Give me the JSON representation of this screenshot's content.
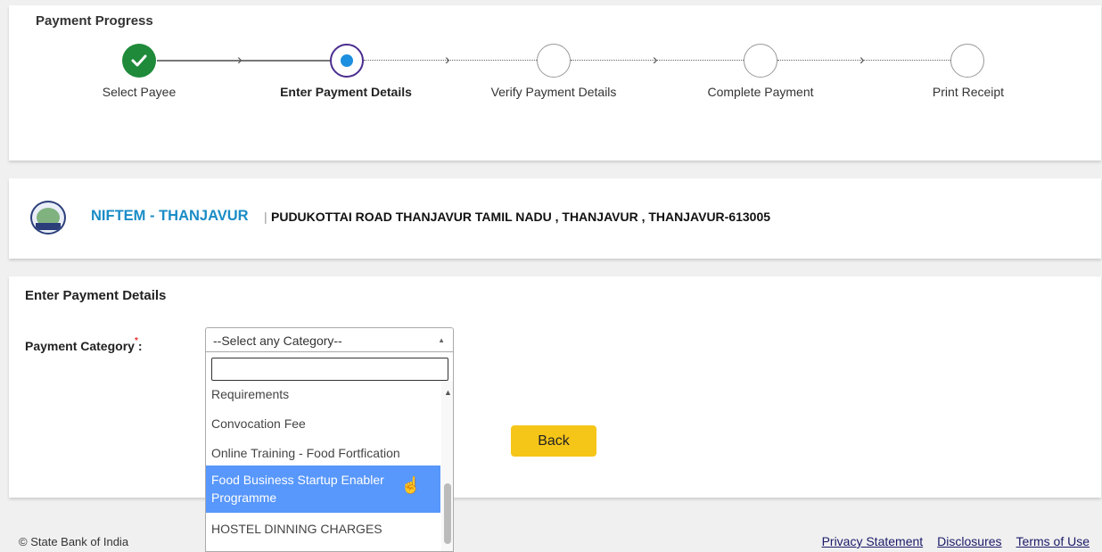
{
  "progress": {
    "title": "Payment Progress",
    "steps": [
      {
        "label": "Select Payee",
        "state": "done"
      },
      {
        "label": "Enter Payment Details",
        "state": "active"
      },
      {
        "label": "Verify Payment Details",
        "state": "pending"
      },
      {
        "label": "Complete Payment",
        "state": "pending"
      },
      {
        "label": "Print Receipt",
        "state": "pending"
      }
    ]
  },
  "organization": {
    "name": "NIFTEM - THANJAVUR",
    "separator": "|",
    "address": "PUDUKOTTAI ROAD THANJAVUR TAMIL NADU , THANJAVUR , THANJAVUR-613005",
    "logo_icon": "niftem-logo-icon"
  },
  "form": {
    "title": "Enter Payment Details",
    "category_label": "Payment Category",
    "required_mark": "*",
    "label_colon": ":",
    "selected_value": "--Select any Category--",
    "back_label": "Back"
  },
  "dropdown": {
    "search_value": "",
    "items": [
      {
        "label": "Requirements",
        "highlighted": false
      },
      {
        "label": "Convocation Fee",
        "highlighted": false
      },
      {
        "label": "Online Training - Food Fortfication",
        "highlighted": false
      },
      {
        "label": "Food Business Startup Enabler Programme",
        "highlighted": true
      },
      {
        "label": "HOSTEL DINNING CHARGES",
        "highlighted": false
      }
    ]
  },
  "footer": {
    "copyright": "© State Bank of India",
    "links": [
      "Privacy Statement",
      "Disclosures",
      "Terms of Use"
    ]
  },
  "colors": {
    "done": "#1e8a3a",
    "active_ring": "#4b2d8f",
    "active_dot": "#1c8fe0",
    "org_name": "#1a8cc6",
    "back_button": "#f5c518",
    "highlight": "#5897fb"
  }
}
